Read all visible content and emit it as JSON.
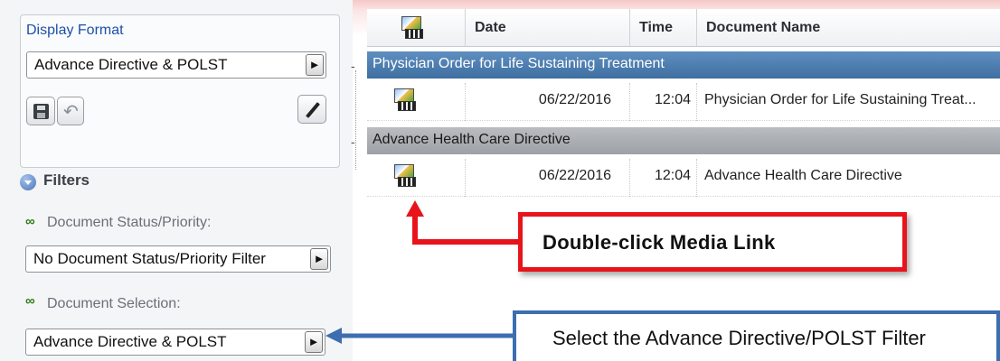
{
  "display_format": {
    "title": "Display Format",
    "selected": "Advance Directive & POLST",
    "buttons": [
      "save-icon",
      "undo-icon",
      "edit-icon"
    ]
  },
  "filters": {
    "title": "Filters",
    "status_label": "Document Status/Priority:",
    "status_value": "No Document Status/Priority Filter",
    "selection_label": "Document Selection:",
    "selection_value": "Advance Directive & POLST"
  },
  "grid": {
    "columns": [
      "Date",
      "Time",
      "Document Name"
    ],
    "groups": [
      {
        "name": "Physician Order for Life Sustaining Treatment",
        "rows": [
          {
            "date": "06/22/2016",
            "time": "12:04",
            "document": "Physician Order for Life Sustaining Treat..."
          }
        ]
      },
      {
        "name": "Advance Health Care Directive",
        "rows": [
          {
            "date": "06/22/2016",
            "time": "12:04",
            "document": "Advance Health Care Directive"
          }
        ]
      }
    ]
  },
  "callouts": {
    "red": "Double-click Media Link",
    "blue": "Select the Advance Directive/POLST Filter"
  },
  "colors": {
    "red_callout": "#e8141b",
    "blue_callout": "#3c6eb0",
    "group_header_blue": "#4f7fb1",
    "group_header_gray": "#a9acb0"
  }
}
